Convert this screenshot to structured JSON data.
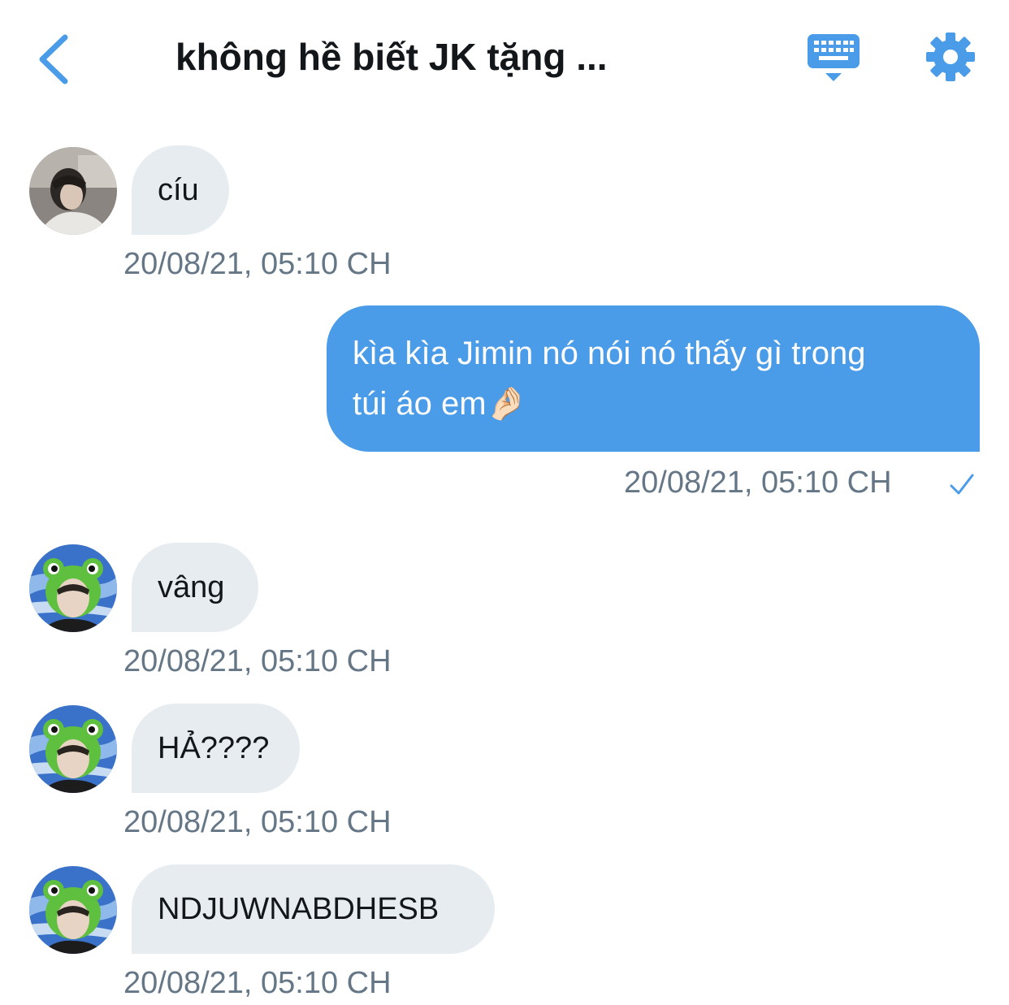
{
  "header": {
    "title": "không hề biết JK tặng ...",
    "back_icon": "chevron-left-icon",
    "keyboard_icon": "keyboard-icon",
    "settings_icon": "gear-icon",
    "accent_color": "#4a9be8"
  },
  "messages": [
    {
      "direction": "incoming",
      "text": "cíu",
      "timestamp": "20/08/21, 05:10 CH"
    },
    {
      "direction": "outgoing",
      "text_line1": "kìa kìa Jimin nó nói nó thấy gì trong",
      "text_line2": "túi áo em🤌🏻",
      "timestamp": "20/08/21, 05:10 CH",
      "status_icon": "check-icon"
    },
    {
      "direction": "incoming",
      "text": "vâng",
      "timestamp": "20/08/21, 05:10 CH"
    },
    {
      "direction": "incoming",
      "text": "HẢ????",
      "timestamp": "20/08/21, 05:10 CH"
    },
    {
      "direction": "incoming",
      "text": "NDJUWNABDHESB",
      "timestamp": "20/08/21, 05:10 CH"
    }
  ],
  "colors": {
    "incoming_bubble": "#e6ecf0",
    "outgoing_bubble": "#4a9be8",
    "timestamp": "#657786"
  }
}
